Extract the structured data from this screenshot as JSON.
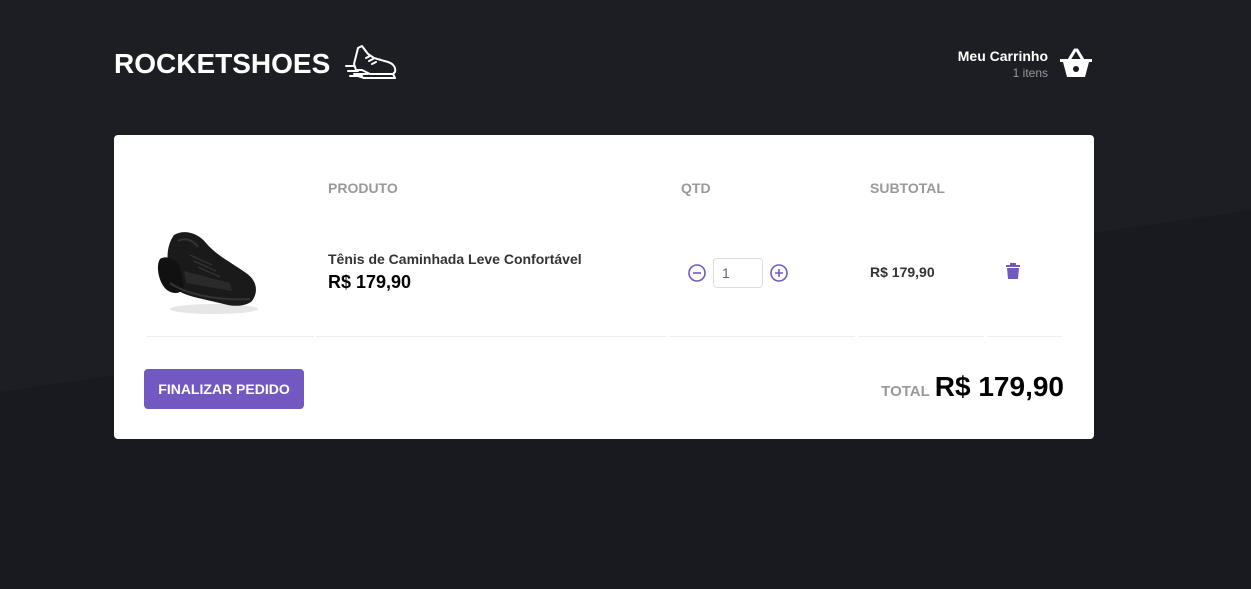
{
  "header": {
    "logo_text": "ROCKETSHOES",
    "logo_icon": "running-shoe-icon",
    "cart_title": "Meu Carrinho",
    "cart_count": "1 itens",
    "cart_icon": "basket-icon"
  },
  "table": {
    "headers": [
      "",
      "PRODUTO",
      "QTD",
      "SUBTOTAL",
      ""
    ],
    "rows": [
      {
        "title": "Tênis de Caminhada Leve Confortável",
        "price": "R$ 179,90",
        "quantity": "1",
        "subtotal": "R$ 179,90"
      }
    ]
  },
  "footer": {
    "finalize_label": "Finalizar pedido",
    "total_label": "TOTAL",
    "total_value": "R$ 179,90"
  },
  "colors": {
    "background": "#191920",
    "accent": "#7159c1",
    "card": "#ffffff"
  }
}
